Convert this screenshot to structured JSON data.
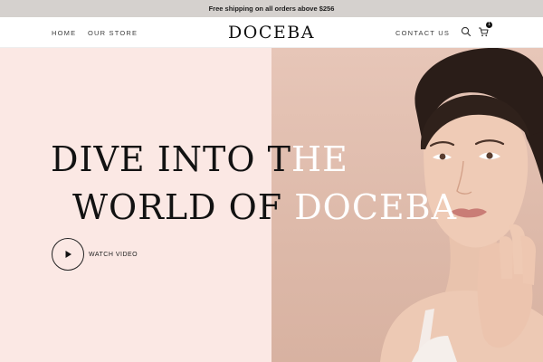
{
  "announcement": {
    "text": "Free shipping on all orders above $256"
  },
  "nav": {
    "left_links": [
      "HOME",
      "OUR STORE"
    ],
    "logo": "DOCEBA",
    "right_links": [
      "CONTACT US"
    ],
    "cart_count": "1",
    "icons": [
      "search-icon",
      "cart-icon"
    ]
  },
  "hero": {
    "headline_line1": {
      "dark": "DIVE INTO T",
      "light": "HE"
    },
    "headline_line2": {
      "dark": "WORLD OF ",
      "light": "DOCEBA"
    },
    "watch_label": "WATCH VIDEO"
  },
  "colors": {
    "announcement_bg": "#d5d1ce",
    "hero_left_bg": "#fbe8e4",
    "hero_right_bg": "#e3c2b4",
    "text_dark": "#121212"
  }
}
